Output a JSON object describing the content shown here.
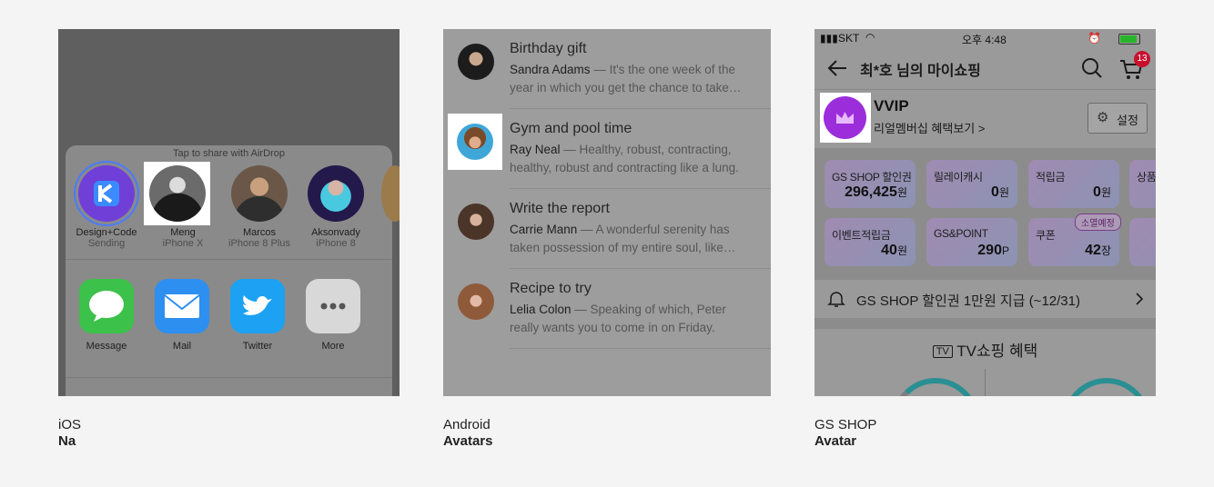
{
  "ios": {
    "caption_platform": "iOS",
    "caption_component": "Na",
    "airdrop_hint": "Tap to share with AirDrop",
    "people": [
      {
        "name": "Design+Code",
        "sub": "Sending"
      },
      {
        "name": "Meng",
        "sub": "iPhone X"
      },
      {
        "name": "Marcos",
        "sub": "iPhone 8 Plus"
      },
      {
        "name": "Aksonvady",
        "sub": "iPhone 8"
      }
    ],
    "apps": [
      {
        "label": "Message",
        "color": "#3cc14a"
      },
      {
        "label": "Mail",
        "color": "#2d8ff0"
      },
      {
        "label": "Twitter",
        "color": "#1da1f2"
      },
      {
        "label": "More",
        "color": "#d8d8d8"
      }
    ]
  },
  "android": {
    "caption_platform": "Android",
    "caption_component": "Avatars",
    "emails": [
      {
        "subject": "Birthday gift",
        "sender": "Sandra Adams",
        "snippet": " — It's the one week of the year in which you get the chance to take…"
      },
      {
        "subject": "Gym and pool time",
        "sender": "Ray Neal",
        "snippet": " — Healthy, robust, contracting, healthy, robust and contracting like a lung."
      },
      {
        "subject": "Write the report",
        "sender": "Carrie Mann",
        "snippet": " — A wonderful serenity has taken possession of my entire soul, like…"
      },
      {
        "subject": "Recipe to try",
        "sender": "Lelia Colon",
        "snippet": " — Speaking of which, Peter really wants you to come in on Friday."
      }
    ]
  },
  "gs": {
    "caption_platform": "GS SHOP",
    "caption_component": "Avatar",
    "status": {
      "carrier": "SKT",
      "time": "오후 4:48"
    },
    "title": "최*호 님의 마이쇼핑",
    "cart_count": "13",
    "tier": "VVIP",
    "benefit_link": "리얼멤버십 혜택보기 >",
    "settings_label": "설정",
    "cards": [
      {
        "label": "GS SHOP 할인권",
        "value": "296,425",
        "unit": "원"
      },
      {
        "label": "릴레이캐시",
        "value": "0",
        "unit": "원"
      },
      {
        "label": "적립금",
        "value": "0",
        "unit": "원"
      },
      {
        "label": "상품",
        "value": "",
        "unit": ""
      },
      {
        "label": "이벤트적립금",
        "value": "40",
        "unit": "원"
      },
      {
        "label": "GS&POINT",
        "value": "290",
        "unit": "P"
      },
      {
        "label": "쿠폰",
        "value": "42",
        "unit": "장"
      }
    ],
    "coupon_badge": "소멸예정",
    "notice": "GS SHOP 할인권 1만원 지급 (~12/31)",
    "tv_label": "TV",
    "tv_section": "TV쇼핑 혜택"
  }
}
